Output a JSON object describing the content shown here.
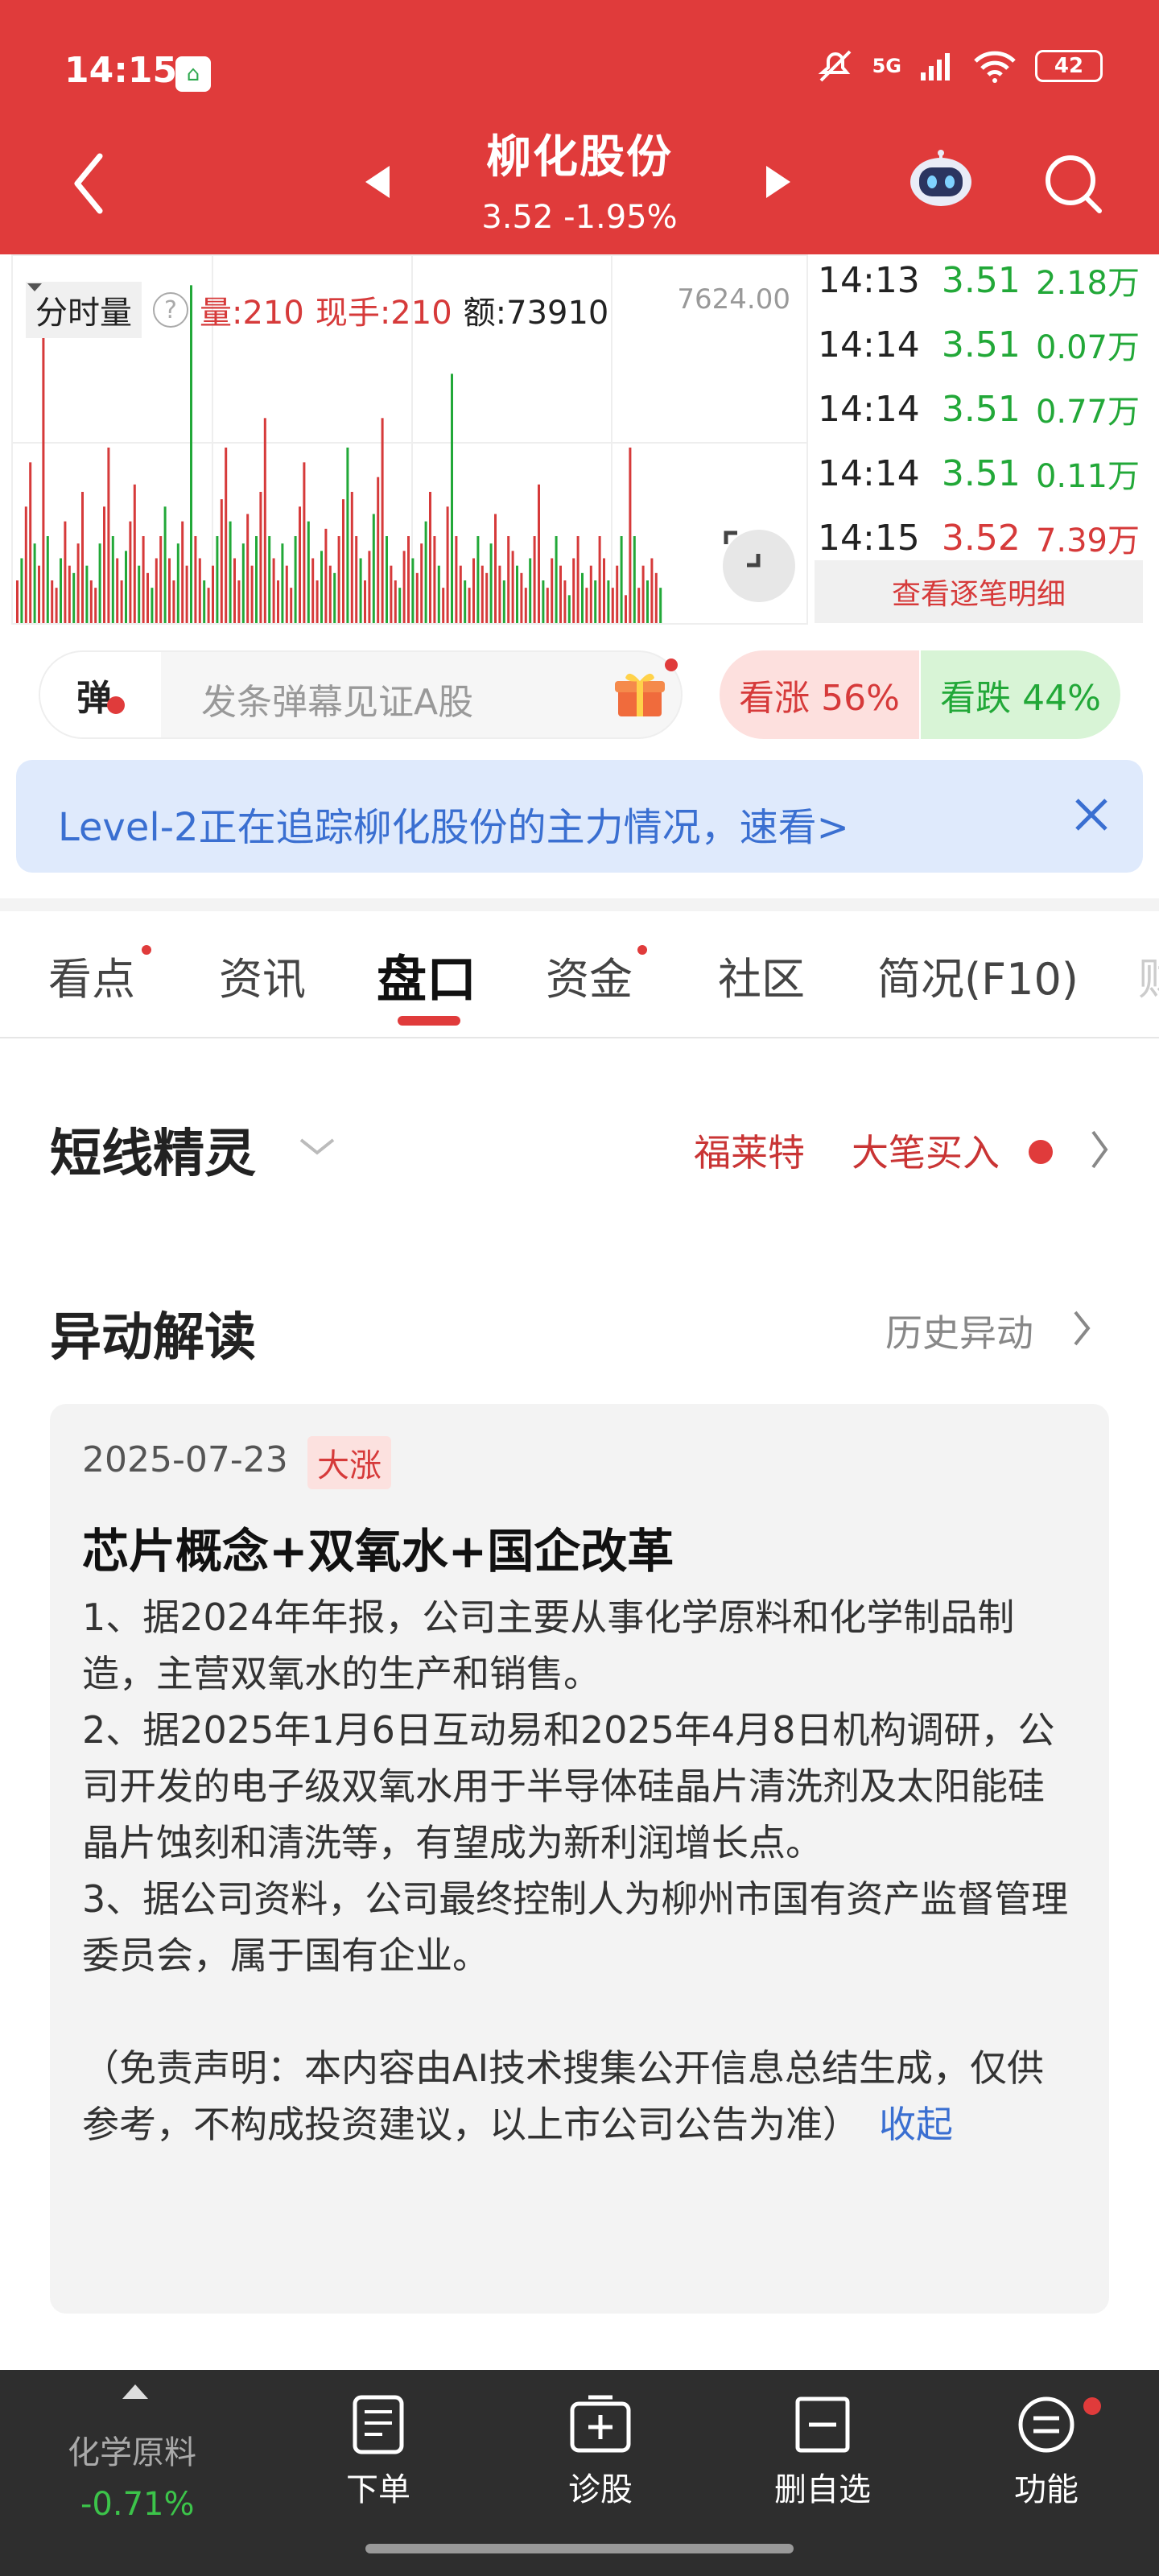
{
  "status_bar": {
    "time": "14:15",
    "network": "5G",
    "battery": "42"
  },
  "header": {
    "stock_name": "柳化股份",
    "quote": "3.52  -1.95%"
  },
  "chart": {
    "selector_label": "分时量",
    "volume": "量:210",
    "hand": "现手:210",
    "amount": "额:73910",
    "max_volume": "7624.00",
    "bars": [
      30,
      45,
      80,
      110,
      55,
      40,
      210,
      60,
      30,
      25,
      45,
      70,
      40,
      35,
      55,
      90,
      40,
      30,
      25,
      55,
      80,
      120,
      60,
      45,
      30,
      50,
      70,
      95,
      40,
      60,
      35,
      25,
      45,
      60,
      80,
      45,
      30,
      55,
      70,
      40,
      230,
      60,
      45,
      30,
      25,
      40,
      60,
      85,
      120,
      70,
      45,
      30,
      55,
      75,
      40,
      60,
      90,
      140,
      60,
      45,
      30,
      55,
      40,
      25,
      60,
      80,
      110,
      70,
      45,
      30,
      50,
      65,
      40,
      35,
      60,
      85,
      120,
      90,
      60,
      45,
      30,
      50,
      75,
      100,
      140,
      60,
      40,
      30,
      25,
      50,
      60,
      45,
      35,
      55,
      70,
      90,
      60,
      40,
      25,
      80,
      170,
      60,
      40,
      30,
      25,
      45,
      60,
      40,
      35,
      55,
      75,
      40,
      30,
      60,
      50,
      40,
      35,
      25,
      45,
      60,
      95,
      30,
      25,
      45,
      60,
      40,
      30,
      20,
      45,
      60,
      35,
      25,
      40,
      30,
      60,
      45,
      30,
      25,
      40,
      60,
      20,
      120,
      60,
      25,
      40,
      30,
      45,
      35,
      25
    ],
    "bar_colors": [
      "r",
      "g"
    ]
  },
  "ticks": [
    {
      "time": "14:13",
      "price": "3.51",
      "vol": "2.18万",
      "dir": "down"
    },
    {
      "time": "14:14",
      "price": "3.51",
      "vol": "0.07万",
      "dir": "down"
    },
    {
      "time": "14:14",
      "price": "3.51",
      "vol": "0.77万",
      "dir": "down"
    },
    {
      "time": "14:14",
      "price": "3.51",
      "vol": "0.11万",
      "dir": "down"
    },
    {
      "time": "14:15",
      "price": "3.52",
      "vol": "7.39万",
      "dir": "up"
    }
  ],
  "tick_detail_label": "查看逐笔明细",
  "danmu": {
    "icon_text": "弹",
    "placeholder": "发条弹幕见证A股"
  },
  "sentiment": {
    "up": "看涨 56%",
    "down": "看跌 44%"
  },
  "banner": {
    "text": "Level-2正在追踪柳化股份的主力情况，速看>"
  },
  "tabs": [
    "看点",
    "资讯",
    "盘口",
    "资金",
    "社区",
    "简况(F10)",
    "财"
  ],
  "sprite": {
    "title": "短线精灵",
    "name": "福莱特",
    "event": "大笔买入"
  },
  "anomaly": {
    "title": "异动解读",
    "history_label": "历史异动",
    "date": "2025-07-23",
    "tag": "大涨",
    "headline": "芯片概念+双氧水+国企改革",
    "paragraphs": [
      "1、据2024年年报，公司主要从事化学原料和化学制品制造，主营双氧水的生产和销售。",
      "2、据2025年1月6日互动易和2025年4月8日机构调研，公司开发的电子级双氧水用于半导体硅晶片清洗剂及太阳能硅晶片蚀刻和清洗等，有望成为新利润增长点。",
      "3、据公司资料，公司最终控制人为柳州市国有资产监督管理委员会，属于国有企业。"
    ],
    "disclaimer": "（免责声明：本内容由AI技术搜集公开信息总结生成，仅供参考，不构成投资建议，以上市公司公告为准）",
    "collapse_label": "收起"
  },
  "bottom_bar": {
    "sector_name": "化学原料",
    "sector_change": "-0.71%",
    "nav": [
      "下单",
      "诊股",
      "删自选",
      "功能"
    ]
  }
}
